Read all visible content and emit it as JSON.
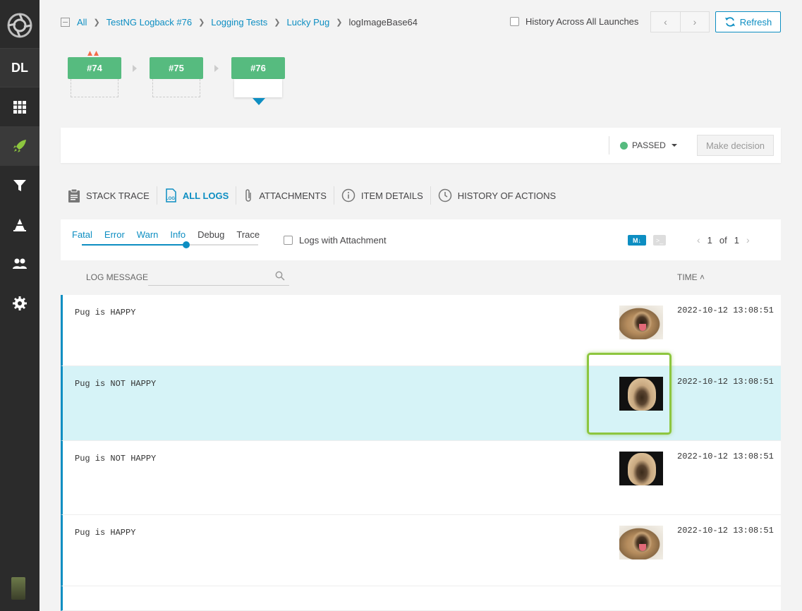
{
  "sidebar": {
    "project_initials": "DL",
    "items": [
      {
        "icon": "dashboard-grid-icon"
      },
      {
        "icon": "launches-rocket-icon"
      },
      {
        "icon": "filter-icon"
      },
      {
        "icon": "debug-cone-icon"
      },
      {
        "icon": "members-icon"
      },
      {
        "icon": "settings-gear-icon"
      }
    ]
  },
  "breadcrumb": {
    "items": [
      "All",
      "TestNG Logback #76",
      "Logging Tests",
      "Lucky Pug"
    ],
    "current": "logImageBase64"
  },
  "header": {
    "history_label": "History Across All Launches",
    "refresh_label": "Refresh"
  },
  "history": {
    "launches": [
      "#74",
      "#75",
      "#76"
    ]
  },
  "status": {
    "value": "PASSED",
    "color": "#56bb7f",
    "decision_label": "Make decision"
  },
  "tabs": [
    {
      "label": "STACK TRACE",
      "icon": "clipboard-icon"
    },
    {
      "label": "ALL LOGS",
      "icon": "log-icon"
    },
    {
      "label": "ATTACHMENTS",
      "icon": "paperclip-icon"
    },
    {
      "label": "ITEM DETAILS",
      "icon": "info-icon"
    },
    {
      "label": "HISTORY OF ACTIONS",
      "icon": "clock-icon"
    }
  ],
  "log_levels": [
    "Fatal",
    "Error",
    "Warn",
    "Info",
    "Debug",
    "Trace"
  ],
  "log_level_selected": "Info",
  "logs_with_attachment_label": "Logs with Attachment",
  "markdown_label": "M↓",
  "console_label": ">_",
  "pager": {
    "current": "1",
    "of_label": "of",
    "total": "1"
  },
  "columns": {
    "message": "LOG MESSAGE",
    "time": "TIME"
  },
  "rows": [
    {
      "message": "Pug is HAPPY",
      "time": "2022-10-12 13:08:51",
      "thumb": "happy"
    },
    {
      "message": "Pug is NOT HAPPY",
      "time": "2022-10-12 13:08:51",
      "thumb": "nothappy"
    },
    {
      "message": "Pug is NOT HAPPY",
      "time": "2022-10-12 13:08:51",
      "thumb": "nothappy"
    },
    {
      "message": "Pug is HAPPY",
      "time": "2022-10-12 13:08:51",
      "thumb": "happy"
    }
  ],
  "colors": {
    "accent": "#0d8ec2",
    "passed": "#56bb7f",
    "selected_row": "#d6f3f7",
    "highlight": "#8dc63f"
  }
}
